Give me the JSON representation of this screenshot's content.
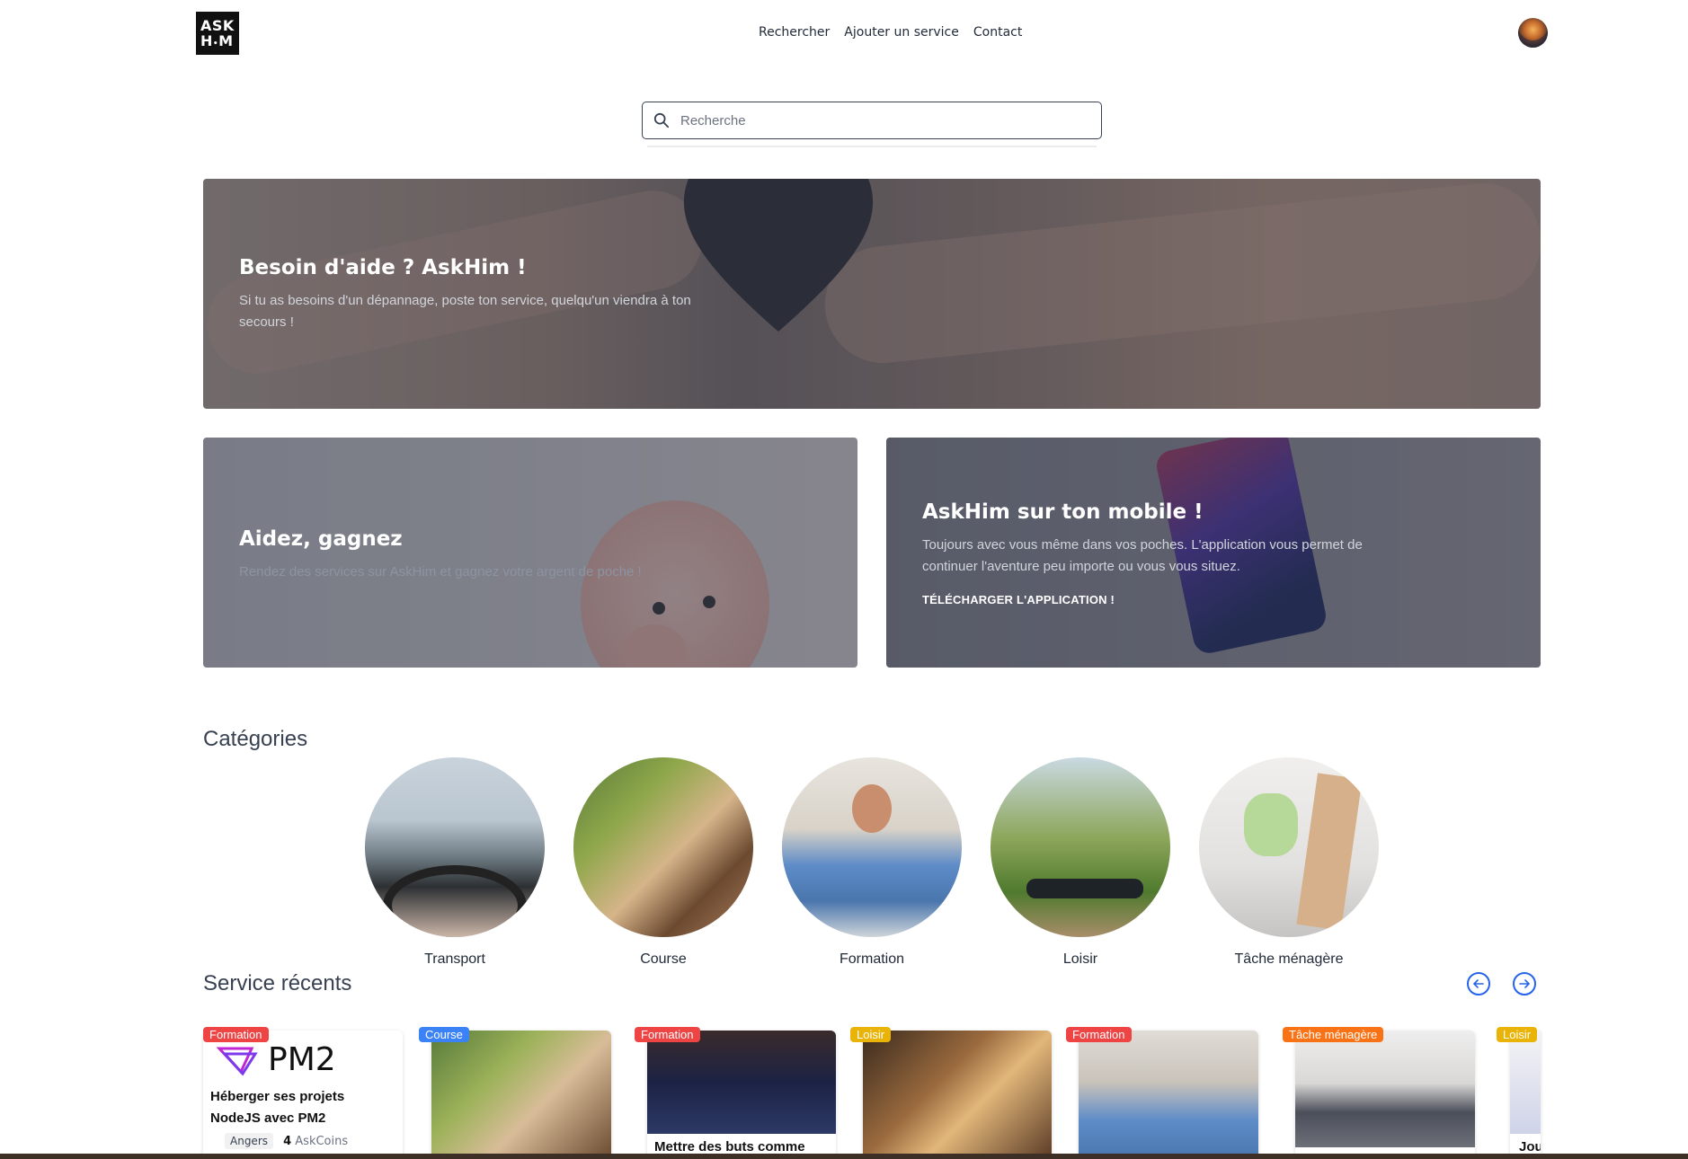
{
  "header": {
    "logo_text": "ASK H.M",
    "nav": [
      {
        "label": "Rechercher"
      },
      {
        "label": "Ajouter un service"
      },
      {
        "label": "Contact"
      }
    ]
  },
  "search": {
    "placeholder": "Recherche",
    "value": ""
  },
  "hero": {
    "title": "Besoin d'aide ? AskHim !",
    "text": "Si tu as besoins d'un dépannage, poste ton service, quelqu'un viendra à ton secours !"
  },
  "banner_money": {
    "title": "Aidez, gagnez",
    "text": "Rendez des services sur AskHim et gagnez votre argent de poche !"
  },
  "banner_mobile": {
    "title": "AskHim sur ton mobile !",
    "text": "Toujours avec vous même dans vos poches. L'application vous permet de continuer l'aventure peu importe ou vous vous situez.",
    "cta": "TÉLÉCHARGER L'APPLICATION !"
  },
  "categories": {
    "title": "Catégories",
    "items": [
      {
        "label": "Transport"
      },
      {
        "label": "Course"
      },
      {
        "label": "Formation"
      },
      {
        "label": "Loisir"
      },
      {
        "label": "Tâche ménagère"
      }
    ]
  },
  "recent": {
    "title": "Service récents",
    "cards": [
      {
        "badge": "Formation",
        "badge_color": "#ef4444",
        "title": "Héberger ses projets NodeJS avec PM2",
        "city": "Angers",
        "coins": "4",
        "coins_label": "AskCoins",
        "image_text": "PM2"
      },
      {
        "badge": "Course",
        "badge_color": "#3b82f6",
        "title": ""
      },
      {
        "badge": "Formation",
        "badge_color": "#ef4444",
        "title": "Mettre des buts comme"
      },
      {
        "badge": "Loisir",
        "badge_color": "#eab308",
        "title": ""
      },
      {
        "badge": "Formation",
        "badge_color": "#ef4444",
        "title": ""
      },
      {
        "badge": "Tâche ménagère",
        "badge_color": "#f97316",
        "title": ""
      },
      {
        "badge": "Loisir",
        "badge_color": "#eab308",
        "title": "Jou"
      }
    ]
  }
}
